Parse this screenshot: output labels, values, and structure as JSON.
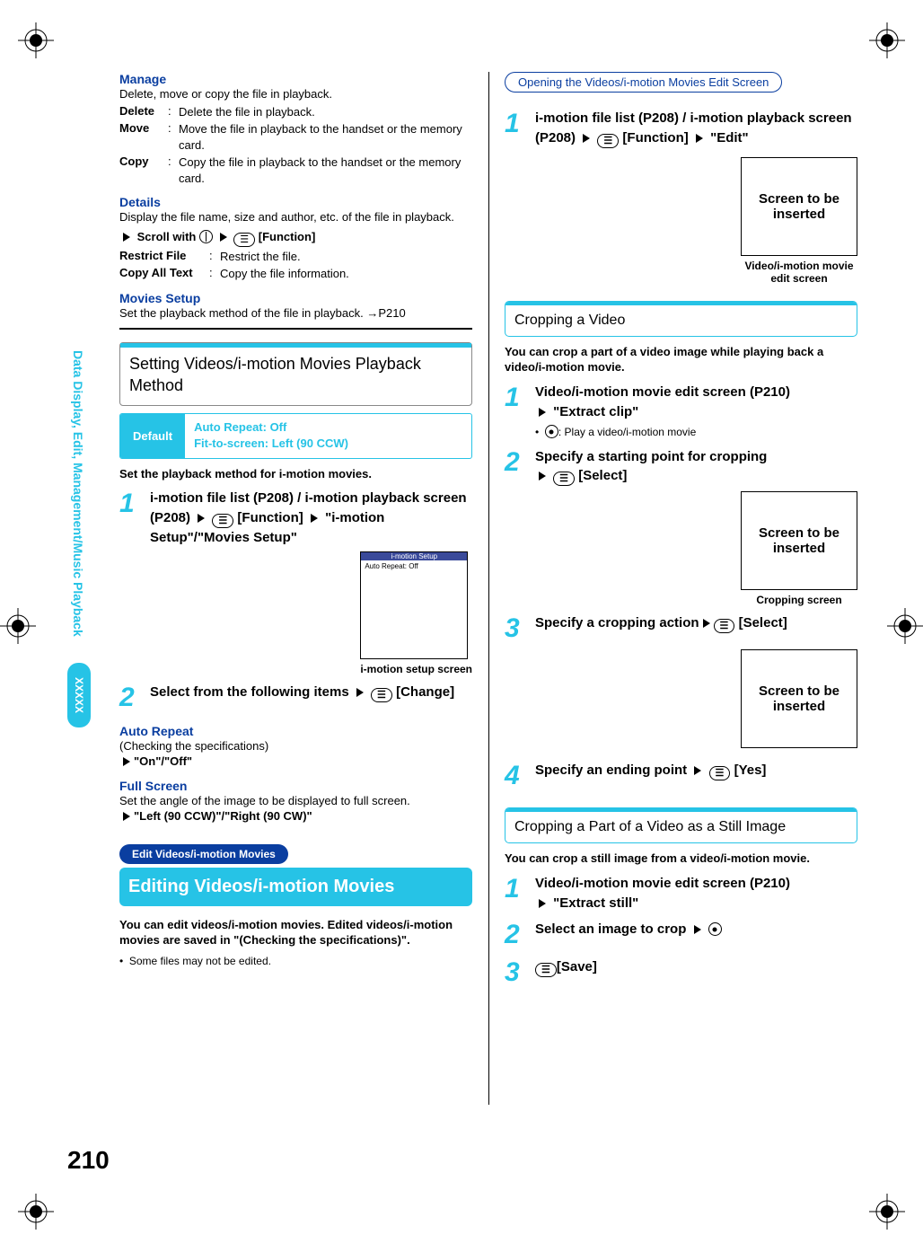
{
  "page_number": "210",
  "sidebar": {
    "label": "Data Display, Edit, Management/Music Playback",
    "tag": "XXXXX"
  },
  "left": {
    "manage": {
      "title": "Manage",
      "desc": "Delete, move or copy the file in playback.",
      "rows": [
        {
          "term": "Delete",
          "text": "Delete the file in playback."
        },
        {
          "term": "Move",
          "text": "Move the file in playback to the handset or the memory card."
        },
        {
          "term": "Copy",
          "text": "Copy the file in playback to the handset or the memory card."
        }
      ]
    },
    "details": {
      "title": "Details",
      "desc": "Display the file name, size and author, etc. of the file in playback.",
      "scroll_prefix": "Scroll with",
      "scroll_suffix": "[Function]",
      "rows": [
        {
          "term": "Restrict File",
          "text": "Restrict the file."
        },
        {
          "term": "Copy All Text",
          "text": "Copy the file information."
        }
      ]
    },
    "movies_setup": {
      "title": "Movies Setup",
      "desc": "Set the playback method of the file in playback. →P210"
    },
    "playback_method": {
      "title": "Setting Videos/i-motion Movies Playback Method",
      "default_label": "Default",
      "default_values": [
        "Auto Repeat: Off",
        "Fit-to-screen: Left (90 CCW)"
      ],
      "intro": "Set the playback method for i-motion movies.",
      "step1_a": "i-motion file list (P208) / i-motion playback screen (P208)",
      "step1_b": "[Function]",
      "step1_c": "\"i-motion Setup\"/\"Movies Setup\"",
      "setup_screen_title": "i-motion Setup",
      "setup_screen_line": "Auto Repeat: Off",
      "caption1": "i-motion setup screen",
      "step2": "Select from the following items",
      "step2_suffix": "[Change]"
    },
    "auto_repeat": {
      "title": "Auto Repeat",
      "sub": "(Checking the specifications)",
      "opt": "\"On\"/\"Off\""
    },
    "full_screen": {
      "title": "Full Screen",
      "sub": "Set the angle of the image to be displayed to full screen.",
      "opt": "\"Left (90 CCW)\"/\"Right (90 CW)\""
    },
    "edit": {
      "hdr": "Edit Videos/i-motion Movies",
      "title": "Editing Videos/i-motion Movies",
      "desc": "You can edit videos/i-motion movies. Edited videos/i-motion movies are saved in \"(Checking the specifications)\".",
      "note": "Some files may not be edited."
    }
  },
  "right": {
    "open": {
      "hdr": "Opening the Videos/i-motion Movies Edit Screen",
      "step1_a": "i-motion file list (P208) / i-motion playback screen (P208)",
      "step1_b": "[Function]",
      "step1_c": "\"Edit\"",
      "placeholder": "Screen to be inserted",
      "caption": "Video/i-motion movie edit screen"
    },
    "crop_video": {
      "title": "Cropping a Video",
      "desc": "You can crop a part of a video image while playing back a video/i-motion movie.",
      "step1_a": "Video/i-motion movie edit screen (P210)",
      "step1_b": "\"Extract clip\"",
      "bullet": ": Play a video/i-motion movie",
      "step2": "Specify a starting point for cropping",
      "step2_suffix": "[Select]",
      "placeholder2": "Screen to be inserted",
      "caption2": "Cropping screen",
      "step3_a": "Specify a cropping action",
      "step3_suffix": "[Select]",
      "placeholder3": "Screen to be inserted",
      "step4": "Specify an ending point",
      "step4_suffix": "[Yes]"
    },
    "crop_still": {
      "title": "Cropping a Part of a Video as a Still Image",
      "desc": "You can crop a still image from a video/i-motion movie.",
      "step1_a": "Video/i-motion movie edit screen (P210)",
      "step1_b": "\"Extract still\"",
      "step2": "Select an image to crop",
      "step3": "[Save]"
    }
  }
}
